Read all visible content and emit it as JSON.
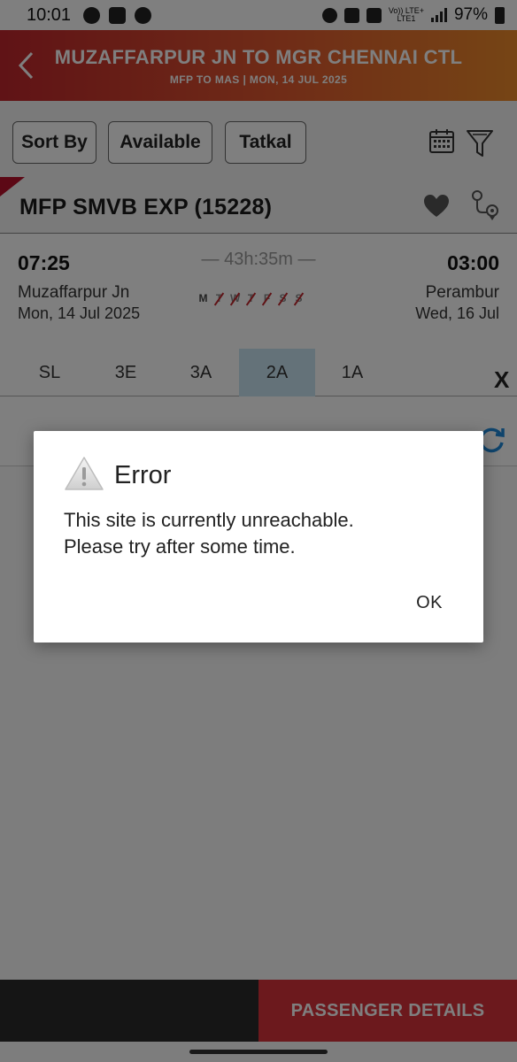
{
  "status_bar": {
    "time": "10:01",
    "network_label_top": "Vo)) LTE+",
    "network_label_bottom": "LTE1",
    "battery": "97%"
  },
  "header": {
    "title": "MUZAFFARPUR JN TO MGR CHENNAI CTL",
    "subtitle": "MFP TO MAS | MON, 14 JUL  2025"
  },
  "filters": {
    "sort_by": "Sort By",
    "available": "Available",
    "tatkal": "Tatkal"
  },
  "train": {
    "name": "MFP SMVB EXP (15228)",
    "departure_time": "07:25",
    "arrival_time": "03:00",
    "duration": "— 43h:35m —",
    "from_station": "Muzaffarpur Jn",
    "from_date": "Mon, 14 Jul  2025",
    "to_station": "Perambur",
    "to_date": "Wed, 16 Jul",
    "run_days": [
      {
        "letter": "M",
        "runs": true
      },
      {
        "letter": "T",
        "runs": false
      },
      {
        "letter": "W",
        "runs": false
      },
      {
        "letter": "T",
        "runs": false
      },
      {
        "letter": "F",
        "runs": false
      },
      {
        "letter": "S",
        "runs": false
      },
      {
        "letter": "S",
        "runs": false
      }
    ]
  },
  "classes": [
    "SL",
    "3E",
    "3A",
    "2A",
    "1A"
  ],
  "selected_class": "2A",
  "close_label": "X",
  "footer": {
    "passenger_details": "PASSENGER DETAILS"
  },
  "dialog": {
    "title": "Error",
    "message_line1": "This site is currently unreachable.",
    "message_line2": "Please try after some time.",
    "ok": "OK"
  },
  "colors": {
    "header_start": "#c0262c",
    "header_end": "#ec8a2a",
    "selected_class_bg": "#c9e4f3",
    "passenger_button": "#d9333a",
    "refresh_icon": "#1e88d8"
  }
}
